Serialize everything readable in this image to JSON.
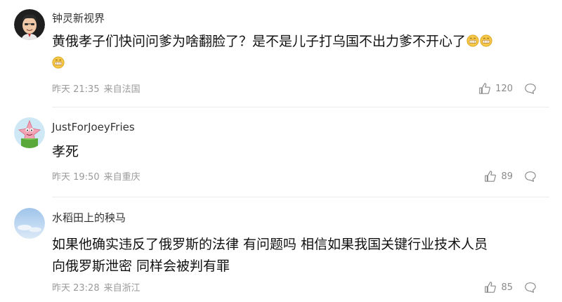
{
  "comments": [
    {
      "username": "钟灵新视界",
      "text_parts": [
        "黄俄孝子们快问问爹为啥翻脸了？是不是儿子打乌国不出力爹不开心了"
      ],
      "time": "昨天 21:35",
      "location": "来自法国",
      "likes": "120",
      "avatar": "cartoon-man-avatar"
    },
    {
      "username": "JustForJoeyFries",
      "text_parts": [
        "孝死"
      ],
      "time": "昨天 19:50",
      "location": "来自重庆",
      "likes": "89",
      "avatar": "patrick-star-avatar"
    },
    {
      "username": "水稻田上的秧马",
      "text_parts": [
        "如果他确实违反了俄罗斯的法律 有问题吗 相信如果我国关键行业技术人员",
        "向俄罗斯泄密 同样会被判有罪"
      ],
      "time": "昨天 23:28",
      "location": "来自浙江",
      "likes": "85",
      "avatar": "sky-photo-avatar"
    }
  ],
  "colors": {
    "background": "#ffffff",
    "username": "#333333",
    "meta": "#9a9a9a",
    "divider": "#ececec",
    "emoji_face": "#f7c948"
  },
  "icons": [
    "thumbs-up-icon",
    "reply-bubble-icon",
    "grin-emoji-icon"
  ]
}
